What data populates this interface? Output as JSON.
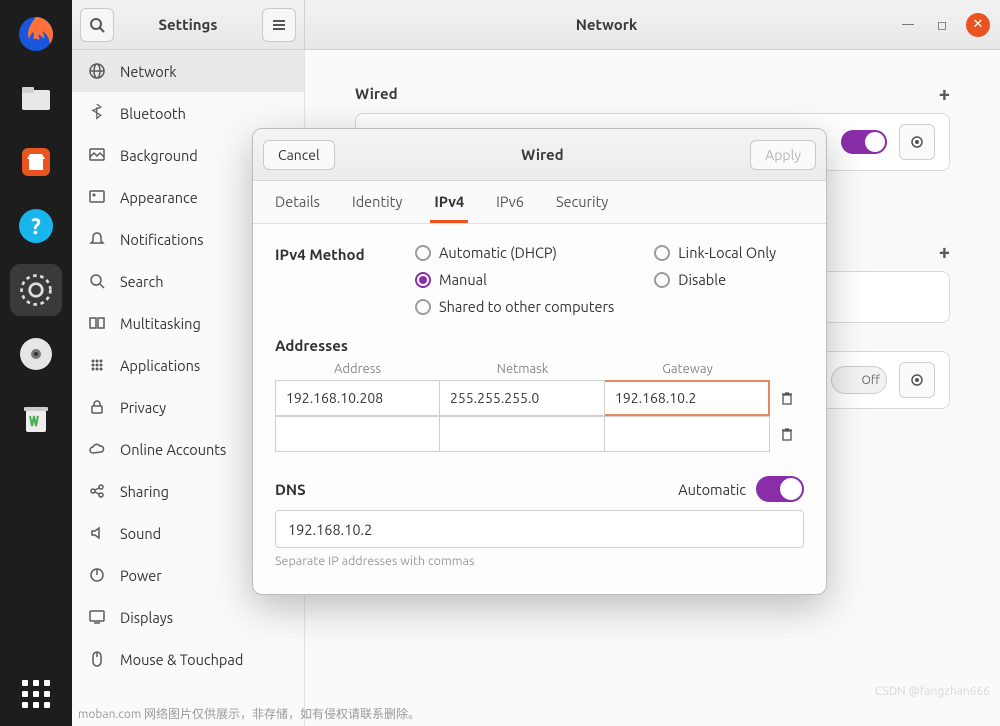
{
  "dock": {
    "items": [
      "firefox",
      "files",
      "software",
      "help",
      "settings",
      "disc",
      "trash"
    ]
  },
  "titlebar": {
    "settings_title": "Settings",
    "window_title": "Network"
  },
  "sidebar": {
    "items": [
      {
        "icon": "globe",
        "label": "Network",
        "active": true
      },
      {
        "icon": "bluetooth",
        "label": "Bluetooth"
      },
      {
        "icon": "background",
        "label": "Background"
      },
      {
        "icon": "appearance",
        "label": "Appearance"
      },
      {
        "icon": "bell",
        "label": "Notifications"
      },
      {
        "icon": "search",
        "label": "Search"
      },
      {
        "icon": "multitask",
        "label": "Multitasking"
      },
      {
        "icon": "apps",
        "label": "Applications"
      },
      {
        "icon": "lock",
        "label": "Privacy"
      },
      {
        "icon": "cloud",
        "label": "Online Accounts"
      },
      {
        "icon": "share",
        "label": "Sharing"
      },
      {
        "icon": "sound",
        "label": "Sound"
      },
      {
        "icon": "power",
        "label": "Power"
      },
      {
        "icon": "display",
        "label": "Displays"
      },
      {
        "icon": "mouse",
        "label": "Mouse & Touchpad"
      }
    ]
  },
  "content": {
    "wired_title": "Wired",
    "vpn_off": "Off"
  },
  "dialog": {
    "cancel": "Cancel",
    "apply": "Apply",
    "title": "Wired",
    "tabs": [
      "Details",
      "Identity",
      "IPv4",
      "IPv6",
      "Security"
    ],
    "active_tab": 2,
    "method_label": "IPv4 Method",
    "methods_col1": [
      "Automatic (DHCP)",
      "Manual",
      "Shared to other computers"
    ],
    "methods_col2": [
      "Link-Local Only",
      "Disable"
    ],
    "method_checked": "Manual",
    "addresses_label": "Addresses",
    "addr_headers": [
      "Address",
      "Netmask",
      "Gateway"
    ],
    "addr_rows": [
      {
        "address": "192.168.10.208",
        "netmask": "255.255.255.0",
        "gateway": "192.168.10.2"
      },
      {
        "address": "",
        "netmask": "",
        "gateway": ""
      }
    ],
    "dns_label": "DNS",
    "dns_auto_label": "Automatic",
    "dns_value": "192.168.10.2",
    "dns_hint": "Separate IP addresses with commas"
  },
  "watermark": "CSDN @fangzhan666",
  "bottom_text": "moban.com 网络图片仅供展示，非存储，如有侵权请联系删除。"
}
